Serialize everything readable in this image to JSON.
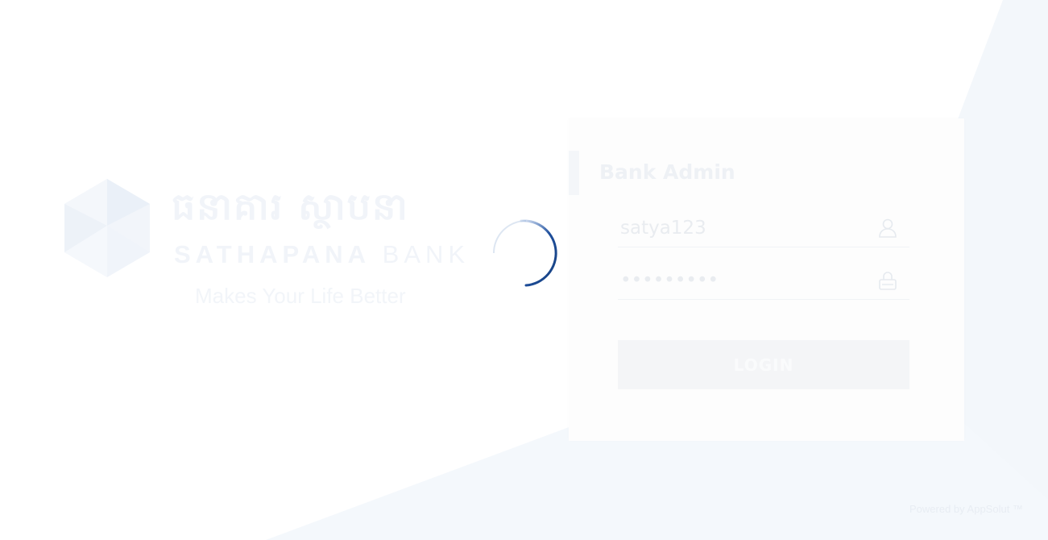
{
  "brand": {
    "khmer_name": "ធនាគារ ស្ថាបនា",
    "name_bold": "SATHAPANA",
    "name_light": "BANK",
    "tagline": "Makes Your Life Better"
  },
  "login": {
    "title": "Bank Admin",
    "username": {
      "value": "satya123",
      "icon": "user-icon"
    },
    "password": {
      "value": "*********",
      "icon": "lock-icon"
    },
    "button_label": "LOGIN"
  },
  "footer": {
    "powered_by": "Powered by AppSolut ™"
  },
  "loading": {
    "icon": "loading-spinner"
  },
  "colors": {
    "spinner": "#1f4f9c",
    "background_panel": "#f3f7fb",
    "faded_text": "#eef1f5"
  }
}
